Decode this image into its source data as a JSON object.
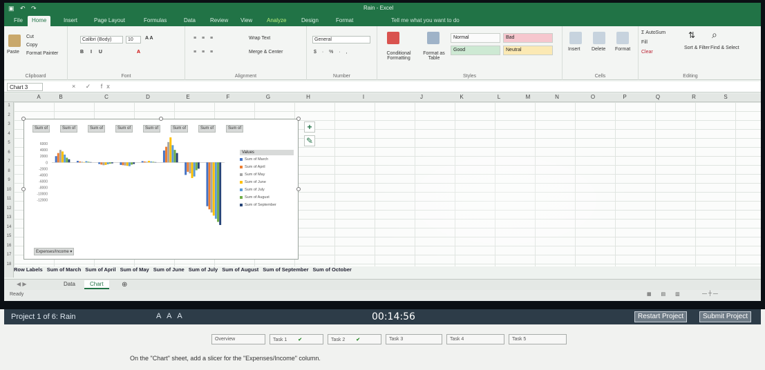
{
  "excel": {
    "window_title": "Rain - Excel",
    "tabs": [
      "File",
      "Home",
      "Insert",
      "Page Layout",
      "Formulas",
      "Data",
      "Review",
      "View",
      "Analyze",
      "Design",
      "Format"
    ],
    "tell_me": "Tell me what you want to do",
    "ribbon": {
      "clipboard": {
        "cut": "Cut",
        "copy": "Copy",
        "format_painter": "Format Painter",
        "paste": "Paste",
        "label": "Clipboard"
      },
      "font": {
        "name": "Calibri (Body)",
        "size": "10",
        "label": "Font"
      },
      "alignment": {
        "wrap": "Wrap Text",
        "merge": "Merge & Center",
        "label": "Alignment"
      },
      "number": {
        "format": "General",
        "label": "Number"
      },
      "styles": {
        "conditional": "Conditional Formatting",
        "format_table": "Format as Table",
        "normal": "Normal",
        "bad": "Bad",
        "good": "Good",
        "neutral": "Neutral",
        "label": "Styles"
      },
      "cells": {
        "insert": "Insert",
        "delete": "Delete",
        "format": "Format",
        "label": "Cells"
      },
      "editing": {
        "autosum": "AutoSum",
        "fill": "Fill",
        "clear": "Clear",
        "sort": "Sort & Filter",
        "find": "Find & Select",
        "label": "Editing"
      }
    },
    "name_box": "Chart 3",
    "columns": [
      "A",
      "B",
      "C",
      "D",
      "E",
      "F",
      "G",
      "H",
      "I",
      "J",
      "K",
      "L",
      "M",
      "N",
      "O",
      "P",
      "Q",
      "R",
      "S"
    ],
    "rows": [
      "1",
      "2",
      "3",
      "4",
      "5",
      "6",
      "7",
      "8",
      "9",
      "10",
      "11",
      "12",
      "13",
      "14",
      "15",
      "16",
      "17",
      "18"
    ],
    "pivot_headers": [
      "Row Labels",
      "Sum of March",
      "Sum of April",
      "Sum of May",
      "Sum of June",
      "Sum of July",
      "Sum of August",
      "Sum of September",
      "Sum of October"
    ],
    "sheet_tabs": [
      "Data",
      "Chart"
    ],
    "active_sheet": "Chart",
    "status": "Ready"
  },
  "chart_data": {
    "type": "bar",
    "field_buttons": [
      "Sum of",
      "Sum of",
      "Sum of",
      "Sum of",
      "Sum of",
      "Sum of",
      "Sum of",
      "Sum of"
    ],
    "legend_title": "Values",
    "categories": [
      "",
      "",
      "",
      "",
      "",
      "",
      "",
      ""
    ],
    "series": [
      {
        "name": "Sum of March",
        "color": "#4472c4",
        "values": [
          2000,
          500,
          -500,
          -800,
          400,
          3800,
          -4000,
          -14000
        ]
      },
      {
        "name": "Sum of April",
        "color": "#ed7d31",
        "values": [
          3000,
          300,
          -700,
          -900,
          300,
          5000,
          -3000,
          -15000
        ]
      },
      {
        "name": "Sum of May",
        "color": "#a5a5a5",
        "values": [
          4000,
          200,
          -900,
          -1000,
          200,
          6500,
          -3500,
          -16000
        ]
      },
      {
        "name": "Sum of June",
        "color": "#ffc000",
        "values": [
          3500,
          100,
          -800,
          -1100,
          500,
          8000,
          -5000,
          -17000
        ]
      },
      {
        "name": "Sum of July",
        "color": "#5b9bd5",
        "values": [
          2500,
          400,
          -600,
          -1200,
          300,
          5500,
          -4500,
          -18000
        ]
      },
      {
        "name": "Sum of August",
        "color": "#70ad47",
        "values": [
          1500,
          200,
          -400,
          -700,
          200,
          4000,
          -2500,
          -19000
        ]
      },
      {
        "name": "Sum of September",
        "color": "#264478",
        "values": [
          1000,
          100,
          -300,
          -500,
          100,
          3000,
          -2000,
          -20000
        ]
      }
    ],
    "ylim": [
      -22000,
      8000
    ],
    "yticks": [
      "6000",
      "4000",
      "2000",
      "0",
      "-2000",
      "-4000",
      "-6000",
      "-8000",
      "-10000",
      "-12000"
    ],
    "footer_button": "Expenses/Income"
  },
  "exam": {
    "project_label": "Project 1 of 6: Rain",
    "font_controls": "A A A",
    "timer": "00:14:56",
    "restart": "Restart Project",
    "submit": "Submit Project",
    "tasks": [
      {
        "label": "Overview",
        "done": ""
      },
      {
        "label": "Task 1",
        "done": "✔"
      },
      {
        "label": "Task 2",
        "done": "✔"
      },
      {
        "label": "Task 3",
        "done": ""
      },
      {
        "label": "Task 4",
        "done": ""
      },
      {
        "label": "Task 5",
        "done": ""
      }
    ],
    "instruction": "On the \"Chart\" sheet, add a slicer for the \"Expenses/Income\" column."
  }
}
